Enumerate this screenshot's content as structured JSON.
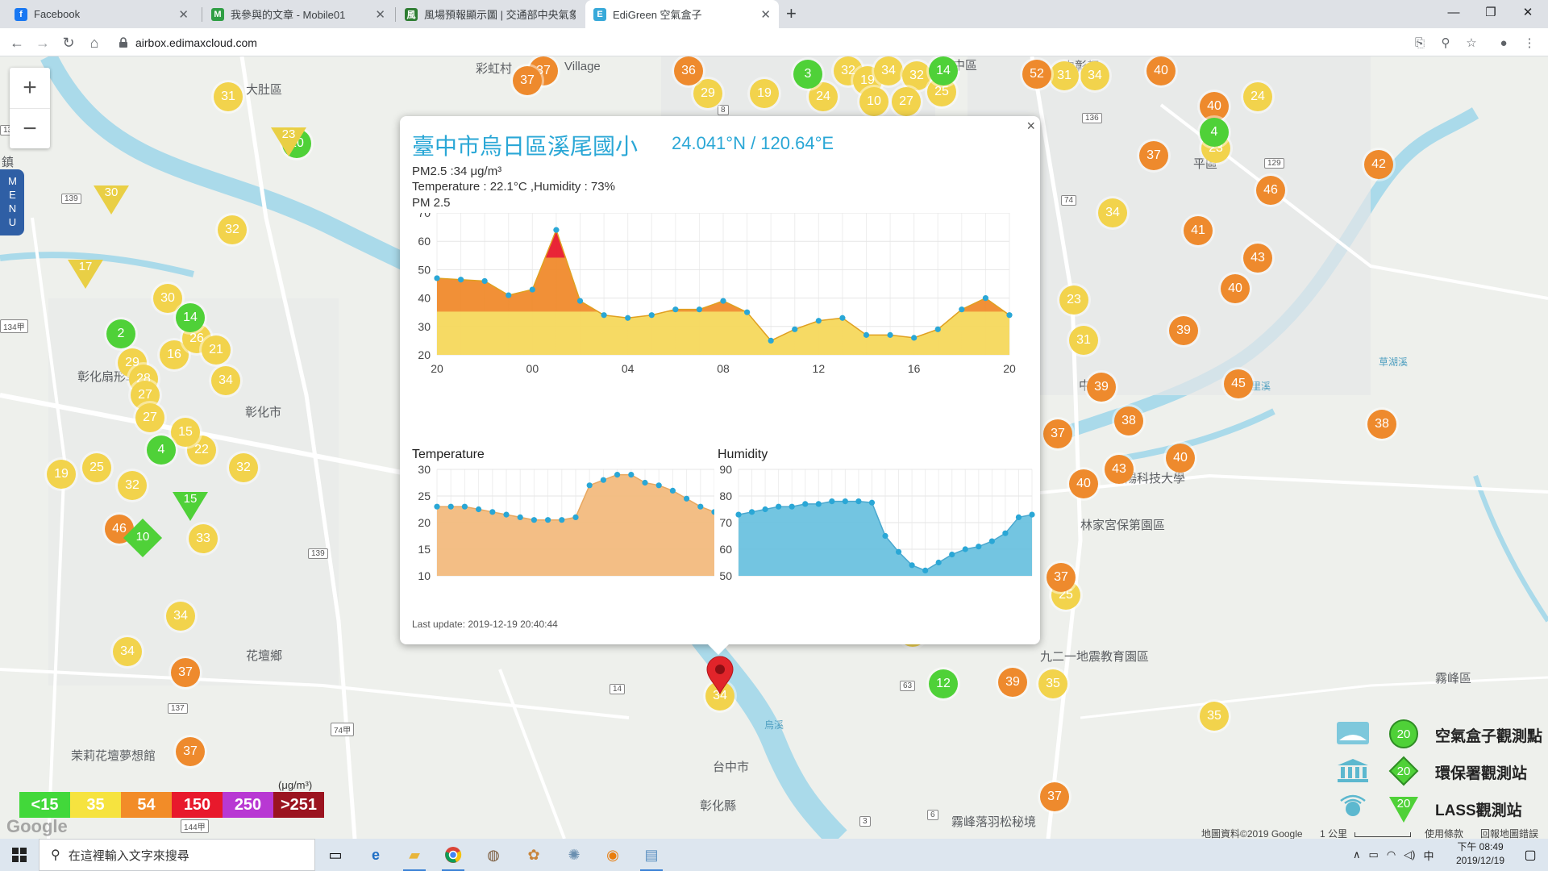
{
  "browser": {
    "tabs": [
      {
        "title": "Facebook",
        "icon": "facebook-icon",
        "color": "#1877f2"
      },
      {
        "title": "我參與的文章 - Mobile01",
        "icon": "mobile01-icon",
        "color": "#2f9e44"
      },
      {
        "title": "風場預報顯示圖 | 交通部中央氣象局",
        "icon": "cwb-icon",
        "color": "#2e7d32"
      },
      {
        "title": "EdiGreen 空氣盒子",
        "icon": "edigreen-icon",
        "color": "#38a9d9"
      }
    ],
    "url": "airbox.edimaxcloud.com"
  },
  "map": {
    "places": [
      "大肚區",
      "彰化市",
      "花壇鄉",
      "霧峰區",
      "中區",
      "平區",
      "茉莉花壇夢想館",
      "九二一地震教育園區",
      "林家宮保第園區",
      "霧峰落羽松秘境",
      "中教",
      "朝陽科技大學",
      "中彰都",
      "彰化扇形車庫",
      "彰化縣",
      "台中市",
      "Village",
      "彩虹村",
      "草湖溪",
      "鎮",
      "大里溪",
      "烏溪"
    ],
    "road_badges": [
      "139",
      "134",
      "134甲",
      "137",
      "14",
      "63",
      "74甲",
      "136",
      "129",
      "139",
      "144甲",
      "144",
      "74",
      "3",
      "6",
      "8",
      "10"
    ],
    "menu_label": "MENU",
    "zoom_in": "+",
    "zoom_out": "−",
    "markers_yellow": [
      "31",
      "32",
      "30",
      "29",
      "16",
      "26",
      "21",
      "34",
      "28",
      "27",
      "27",
      "22",
      "15",
      "19",
      "25",
      "32",
      "32",
      "33",
      "34",
      "34",
      "29",
      "19",
      "24",
      "32",
      "19",
      "34",
      "32",
      "25",
      "27",
      "10",
      "34",
      "23",
      "31",
      "24",
      "34",
      "31",
      "28",
      "25",
      "35",
      "35",
      "23",
      "3",
      "2"
    ],
    "markers_orange": [
      "37",
      "37",
      "36",
      "52",
      "40",
      "40",
      "42",
      "46",
      "41",
      "43",
      "40",
      "37",
      "39",
      "45",
      "38",
      "38",
      "39",
      "37",
      "40",
      "43",
      "40",
      "37",
      "39",
      "37",
      "46",
      "37",
      "37",
      "37"
    ],
    "markers_green": [
      "3",
      "14",
      "4",
      "2",
      "14",
      "20",
      "12",
      "4"
    ],
    "triangles": [
      "23",
      "30",
      "17",
      "15"
    ],
    "diamond": "10",
    "pin_value": "34",
    "legend": [
      {
        "label": "<15",
        "color": "#42d83a"
      },
      {
        "label": "35",
        "color": "#f6e33f"
      },
      {
        "label": "54",
        "color": "#f28c28"
      },
      {
        "label": "150",
        "color": "#e8192c"
      },
      {
        "label": "250",
        "color": "#b838d3"
      },
      {
        "label": ">251",
        "color": "#9b1420"
      }
    ],
    "legend_unit": "(μg/m³)",
    "google": "Google",
    "key": [
      {
        "label": "空氣盒子觀測點",
        "value": "20",
        "icon": "airbox-icon",
        "shape": "circle"
      },
      {
        "label": "環保署觀測站",
        "value": "20",
        "icon": "epa-building-icon",
        "shape": "diamond"
      },
      {
        "label": "LASS觀測站",
        "value": "20",
        "icon": "lass-icon",
        "shape": "triangle"
      }
    ],
    "footer": {
      "copyright": "地圖資料©2019 Google",
      "scale": "1 公里",
      "terms": "使用條款",
      "report": "回報地圖錯誤"
    }
  },
  "popup": {
    "title": "臺中市烏日區溪尾國小",
    "coords": "24.041°N / 120.64°E",
    "pm_line": "PM2.5 :34 μg/m³",
    "th_line": "Temperature : 22.1°C ,Humidity : 73%",
    "pm_label": "PM 2.5",
    "temp_label": "Temperature",
    "hum_label": "Humidity",
    "last_update": "Last update: 2019-12-19 20:40:44",
    "close": "×"
  },
  "chart_data": [
    {
      "type": "area",
      "title": "PM 2.5",
      "x": [
        "20",
        "21",
        "22",
        "23",
        "00",
        "01",
        "02",
        "03",
        "04",
        "05",
        "06",
        "07",
        "08",
        "09",
        "10",
        "11",
        "12",
        "13",
        "14",
        "15",
        "16",
        "17",
        "18",
        "19",
        "20"
      ],
      "x_ticks": [
        "20",
        "00",
        "04",
        "08",
        "12",
        "16",
        "20"
      ],
      "values": [
        47,
        46.5,
        46,
        41,
        43,
        64,
        39,
        34,
        33,
        34,
        36,
        36,
        39,
        35,
        25,
        29,
        32,
        33,
        27,
        27,
        26,
        29,
        36,
        40,
        34
      ],
      "ylim": [
        20,
        70
      ],
      "y_ticks": [
        20,
        30,
        40,
        50,
        60,
        70
      ],
      "color_bands": [
        {
          "below": 35,
          "color": "#f6d85c"
        },
        {
          "below": 54,
          "color": "#f08a2c"
        },
        {
          "below": 70,
          "color": "#e8192c"
        }
      ]
    },
    {
      "type": "area",
      "title": "Temperature",
      "values": [
        23,
        23,
        23,
        22.5,
        22,
        21.5,
        21,
        20.5,
        20.5,
        20.5,
        21,
        27,
        28,
        29,
        29,
        27.5,
        27,
        26,
        24.5,
        23,
        22
      ],
      "ylim": [
        10,
        30
      ],
      "y_ticks": [
        10,
        15,
        20,
        25,
        30
      ],
      "color": "#f2bb7e"
    },
    {
      "type": "area",
      "title": "Humidity",
      "values": [
        73,
        74,
        75,
        76,
        76,
        77,
        77,
        78,
        78,
        78,
        77.5,
        65,
        59,
        54,
        52,
        55,
        58,
        60,
        61,
        63,
        66,
        72,
        73
      ],
      "ylim": [
        50,
        90
      ],
      "y_ticks": [
        50,
        60,
        70,
        80,
        90
      ],
      "color": "#6cc2df"
    }
  ],
  "taskbar": {
    "search_placeholder": "在這裡輸入文字來搜尋",
    "time": "下午 08:49",
    "date": "2019/12/19",
    "ime": "中"
  }
}
